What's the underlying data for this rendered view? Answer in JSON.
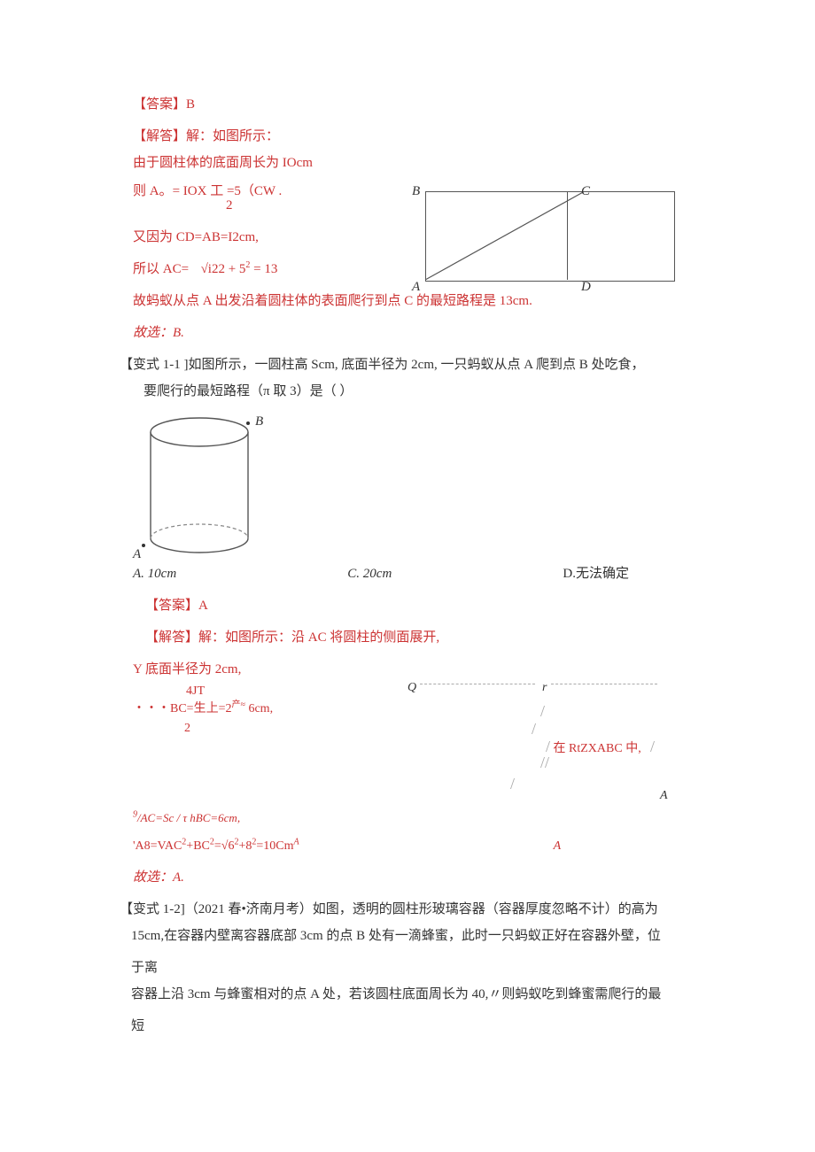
{
  "p": {
    "ansB": "【答案】B",
    "solvHead": "【解答】解：如图所示：",
    "cylPerim": "由于圆柱体的底面周长为 IOcm",
    "thenA_pre": "则 A。= IOX 工 =5（CW .",
    "frac_den_2": "2",
    "cdab": "又因为 CD=AB=I2cm,",
    "ac_pre": "所以 AC=",
    "ac_rad": "√i22 + 5",
    "ac_sup": "2",
    "ac_eq": " = 13",
    "antShort": "故蚂蚁从点 A 出发沿着圆柱体的表面爬行到点 C 的最短路程是 13cm.",
    "pickB": "故选：B.",
    "var11": "【变式 1-1 ]如图所示，一圆柱高 Scm, 底面半径为 2cm,  一只蚂蚁从点 A 爬到点 B 处吃食，",
    "var11b": "要爬行的最短路程（π 取 3）是（        ）",
    "optA": "A. 10cm",
    "optC": "C. 20cm",
    "optD": "D.无法确定",
    "ansA": "【答案】A",
    "solvAC": "【解答】解：如图所示：沿 AC 将圆柱的侧面展开,",
    "yR2": "Y 底面半径为 2cm,",
    "fourJT": "4JT",
    "bc_pre": "・・・BC=生上=2",
    "bc_sup": "产≈",
    "bc_after": "6cm,",
    "two": "2",
    "rtLabel": "在 RtZXABC 中,",
    "acScRow_l": "9",
    "acScRow_m": "/AC=Sc / τ hBC=6cm,",
    "a8row_l": "'A8=",
    "a8row_m": "VAC",
    "a8row_vals": "+BC",
    "a8row_n1": "=√6",
    "a8row_n2": "+8",
    "a8row_eq": "=10Cm",
    "a8row_tail": "A",
    "pickA": "故选：A.",
    "var12": "【变式 1-2]（2021 春•济南月考）如图，透明的圆柱形玻璃容器（容器厚度忽略不计）的高为",
    "var12b": "15cm,在容器内壁离容器底部 3cm 的点 B 处有一滴蜂蜜，此时一只蚂蚁正好在容器外壁，位于离",
    "var12c": "容器上沿 3cm 与蜂蜜相对的点 A 处，若该圆柱底面周长为 40,〃则蚂蚁吃到蜂蜜需爬行的最短"
  },
  "fig1": {
    "A": "A",
    "B": "B",
    "C": "C",
    "D": "D"
  },
  "fig2": {
    "A": "A",
    "B": "B"
  },
  "fig3": {
    "Q": "Q",
    "r": "r",
    "A": "A",
    "slash": "/",
    "dslash": "//"
  }
}
